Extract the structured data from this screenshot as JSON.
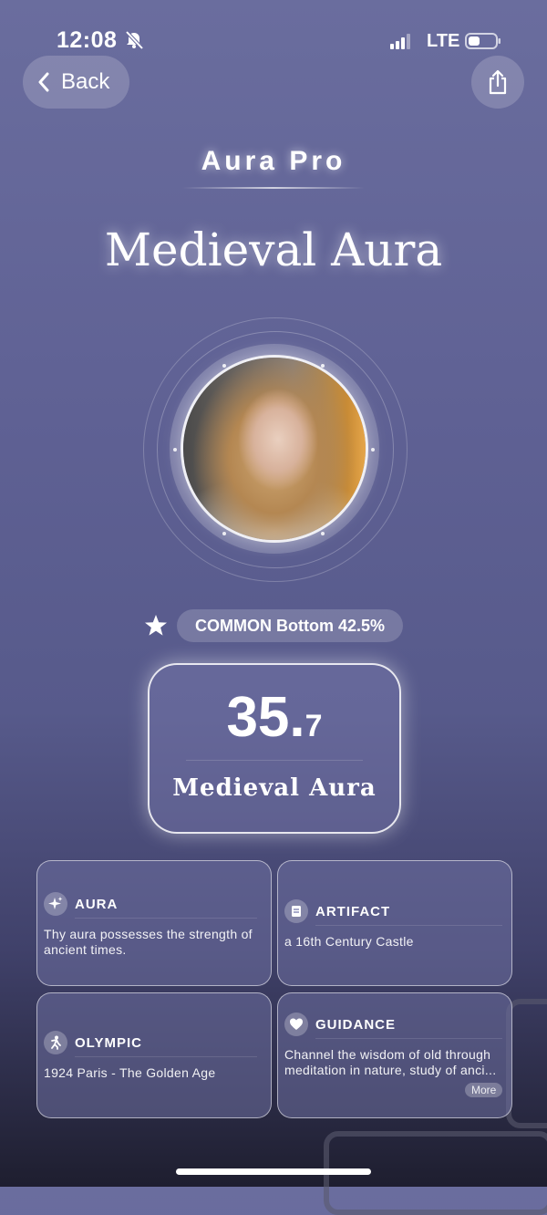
{
  "status_bar": {
    "time": "12:08",
    "network": "LTE"
  },
  "nav": {
    "back_label": "Back"
  },
  "header": {
    "app_title": "Aura Pro",
    "heading": "Medieval Aura"
  },
  "rarity": {
    "label": "COMMON Bottom 42.5%"
  },
  "score": {
    "integer": "35.",
    "decimal": "7",
    "label": "Medieval Aura"
  },
  "cards": [
    {
      "title": "AURA",
      "icon": "sparkle-icon",
      "text": "Thy aura possesses the strength of ancient times."
    },
    {
      "title": "ARTIFACT",
      "icon": "scroll-icon",
      "text": "a 16th Century Castle"
    },
    {
      "title": "OLYMPIC",
      "icon": "athlete-icon",
      "text": "1924 Paris - The Golden Age"
    },
    {
      "title": "GUIDANCE",
      "icon": "heart-icon",
      "text": "Channel the wisdom of old through meditation in nature, study of anci...",
      "more_label": "More"
    }
  ]
}
